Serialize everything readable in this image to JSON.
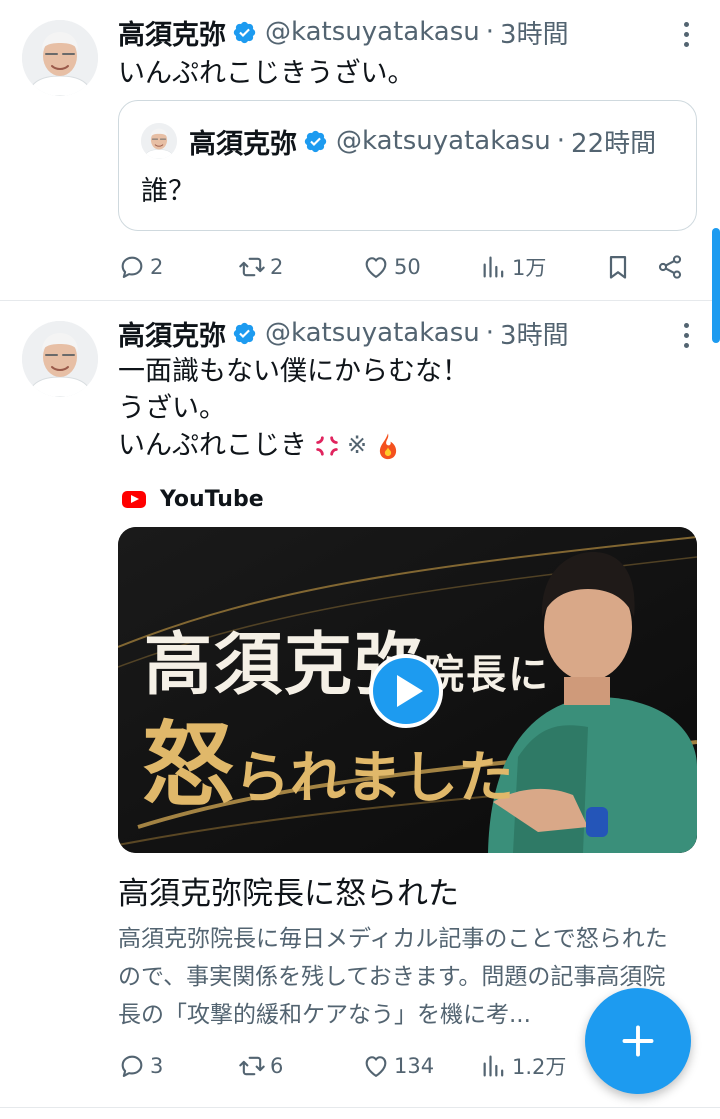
{
  "tweets": [
    {
      "author_name": "高須克弥",
      "handle": "@katsuyatakasu",
      "separator": "·",
      "time": "3時間",
      "text_lines": [
        "いんぷれこじきうざい。"
      ],
      "quote": {
        "author_name": "高須克弥",
        "handle": "@katsuyatakasu",
        "separator": "·",
        "time": "22時間",
        "text": "誰？"
      },
      "stats": {
        "replies": "2",
        "retweets": "2",
        "likes": "50",
        "views": "1万"
      }
    },
    {
      "author_name": "高須克弥",
      "handle": "@katsuyatakasu",
      "separator": "·",
      "time": "3時間",
      "text_lines": [
        "一面識もない僕にからむな！",
        "うざい。",
        "いんぷれこじき"
      ],
      "emojis": [
        "anger-icon",
        "reference-mark-icon",
        "fire-icon"
      ],
      "card": {
        "source": "YouTube",
        "thumbnail_line1": "高須克弥",
        "thumbnail_line1_small": "院長に",
        "thumbnail_line2": "怒",
        "thumbnail_line2_small": "られました",
        "title": "高須克弥院長に怒られた",
        "description_lines": [
          "高須克弥院長に毎日メディカル記事のことで怒られた",
          "ので、事実関係を残しておきます。問題の記事高須院",
          "長の「攻撃的緩和ケアなう」を機に考..."
        ]
      },
      "stats": {
        "replies": "3",
        "retweets": "6",
        "likes": "134",
        "views": "1.2万"
      }
    }
  ],
  "colors": {
    "accent": "#1d9bf0",
    "text": "#0f1419",
    "muted": "#536471",
    "border": "#cfd9de",
    "youtube": "#ff0000"
  }
}
